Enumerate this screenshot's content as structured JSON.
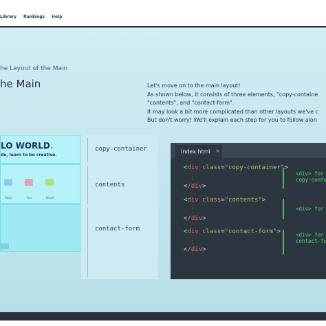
{
  "nav": {
    "items": [
      "Library",
      "Rankings",
      "Help"
    ]
  },
  "page": {
    "breadcrumb": "he Layout of the Main",
    "title": "he Main",
    "paragraph": [
      "Let's move on to the main layout!",
      "As shown below, it consists of three elements, \"copy-containe",
      "\"contents\", and \"contact-form\".",
      "It may look a bit more complicated than other layouts we've c",
      "But don't worry! We'll explain each step for you to follow alon"
    ]
  },
  "preview": {
    "heading": "LO WORLD",
    "heading_dot": ".",
    "subheading": "de, learn to be creative.",
    "cards": [
      {
        "label": "Easy",
        "color": "#8fc6ec"
      },
      {
        "label": "Fun",
        "color": "#e7a0b6"
      },
      {
        "label": "Smart",
        "color": "#b5e06e"
      }
    ]
  },
  "labels": [
    "copy-container",
    "contents",
    "contact-form"
  ],
  "editor": {
    "tab_name": "index.html",
    "tab_close": "×",
    "blocks": [
      {
        "open_tag": "div",
        "attr": "class",
        "value": "\"copy-container\"",
        "close_tag": "/div",
        "comment": [
          "<div> for",
          "copy-conta"
        ]
      },
      {
        "open_tag": "div",
        "attr": "class",
        "value": "\"contents\"",
        "close_tag": "/div",
        "comment": [
          "<div> for c"
        ]
      },
      {
        "open_tag": "div",
        "attr": "class",
        "value": "\"contact-form\"",
        "close_tag": "/div",
        "comment": [
          "<div> for",
          "contact-fo"
        ]
      }
    ],
    "punct": {
      "lt": "<",
      "gt": ">",
      "eq": "=",
      "dots": ":"
    }
  },
  "colors": {
    "tag": "#e2776f",
    "attr": "#d8a85a",
    "string": "#a7cf6a",
    "comment": "#4ee06a"
  }
}
